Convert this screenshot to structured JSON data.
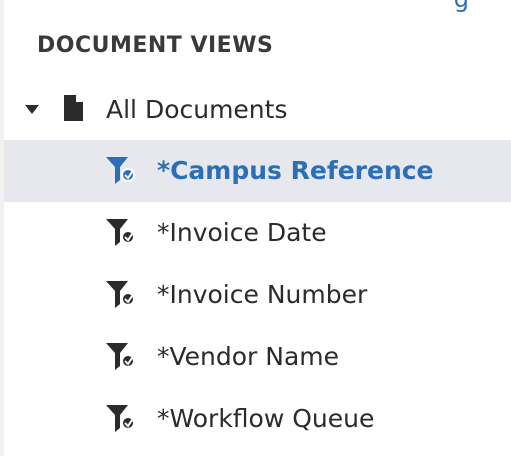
{
  "header": {
    "title": "DOCUMENT VIEWS",
    "top_link_fragment": "g"
  },
  "tree": {
    "root": {
      "label": "All Documents",
      "icon": "document-icon",
      "expanded": true
    },
    "filters": [
      {
        "label": "*Campus Reference",
        "icon": "filter-icon",
        "selected": true
      },
      {
        "label": "*Invoice Date",
        "icon": "filter-icon",
        "selected": false
      },
      {
        "label": "*Invoice Number",
        "icon": "filter-icon",
        "selected": false
      },
      {
        "label": "*Vendor Name",
        "icon": "filter-icon",
        "selected": false
      },
      {
        "label": "*Workflow Queue",
        "icon": "filter-icon",
        "selected": false
      }
    ]
  },
  "colors": {
    "accent": "#2d6fb7",
    "selected_background": "#e6e8ed",
    "text": "#2b2b2b",
    "icon": "#2b2b2b"
  }
}
